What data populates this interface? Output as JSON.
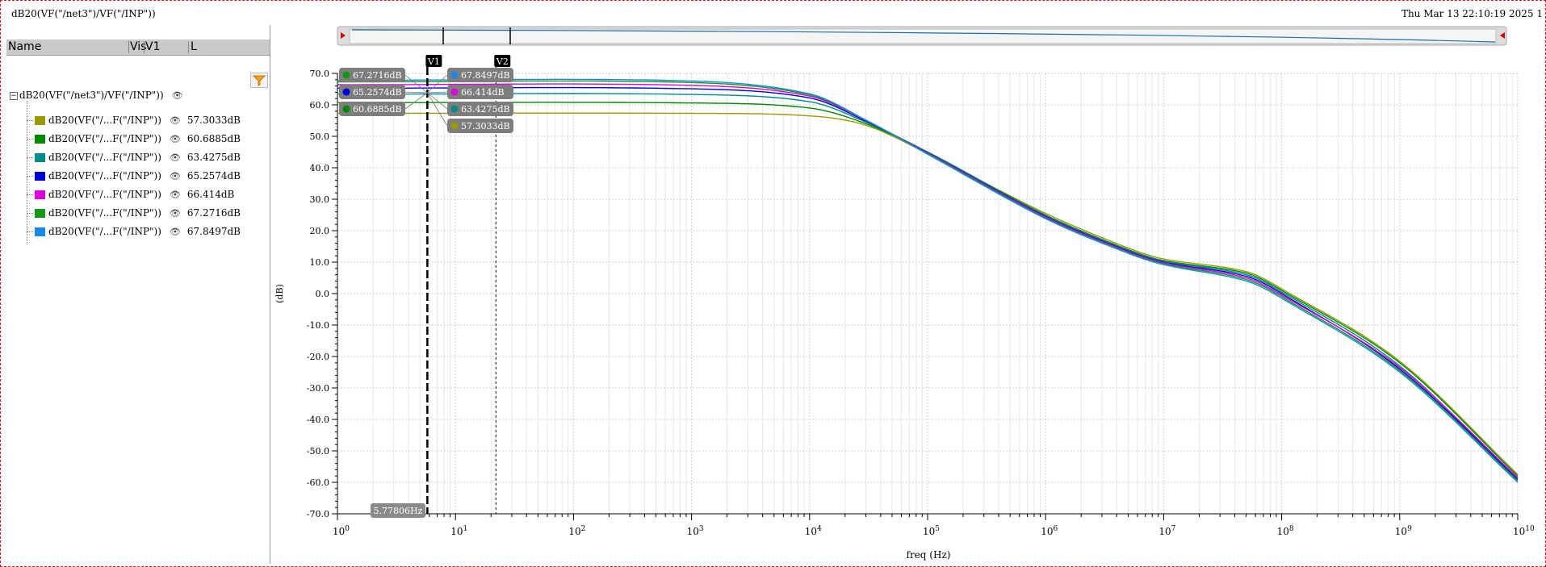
{
  "window": {
    "title": "dB20(VF(\"/net3\")/VF(\"/INP\"))",
    "timestamp": "Thu Mar 13 22:10:19 2025  1"
  },
  "panel": {
    "col_name": "Name",
    "col_vis": "Vis",
    "col_v1": "V1",
    "col_l": "L",
    "root_label": "dB20(VF(\"/net3\")/VF(\"/INP\"))",
    "traces": [
      {
        "label": "dB20(VF(\"/...F(\"/INP\"))",
        "value": "57.3033dB",
        "color": "#999900"
      },
      {
        "label": "dB20(VF(\"/...F(\"/INP\"))",
        "value": "60.6885dB",
        "color": "#008800"
      },
      {
        "label": "dB20(VF(\"/...F(\"/INP\"))",
        "value": "63.4275dB",
        "color": "#008a8a"
      },
      {
        "label": "dB20(VF(\"/...F(\"/INP\"))",
        "value": "65.2574dB",
        "color": "#0000dd"
      },
      {
        "label": "dB20(VF(\"/...F(\"/INP\"))",
        "value": "66.414dB",
        "color": "#dd00dd"
      },
      {
        "label": "dB20(VF(\"/...F(\"/INP\"))",
        "value": "67.2716dB",
        "color": "#119911"
      },
      {
        "label": "dB20(VF(\"/...F(\"/INP\"))",
        "value": "67.8497dB",
        "color": "#1a88e8"
      }
    ]
  },
  "markers": {
    "v1_label": "V1",
    "v2_label": "V2",
    "v1_freq_label": "5.77806Hz",
    "v1_freq": 5.77806,
    "v2_freq": 22,
    "v1_tags": [
      "67.2716dB",
      "65.2574dB",
      "60.6885dB"
    ],
    "v2_tags": [
      "67.8497dB",
      "66.414dB",
      "63.4275dB",
      "57.3033dB"
    ]
  },
  "chart_data": {
    "type": "line",
    "xlabel": "freq (Hz)",
    "ylabel": "(dB)",
    "xscale": "log",
    "xlim": [
      1,
      10000000000
    ],
    "ylim": [
      -70,
      70
    ],
    "y_ticks": [
      "70.0",
      "60.0",
      "50.0",
      "40.0",
      "30.0",
      "20.0",
      "10.0",
      "0.0",
      "-10.0",
      "-20.0",
      "-30.0",
      "-40.0",
      "-50.0",
      "-60.0",
      "-70.0"
    ],
    "x_ticks": [
      {
        "base": "10",
        "exp": "0"
      },
      {
        "base": "10",
        "exp": "1"
      },
      {
        "base": "10",
        "exp": "2"
      },
      {
        "base": "10",
        "exp": "3"
      },
      {
        "base": "10",
        "exp": "4"
      },
      {
        "base": "10",
        "exp": "5"
      },
      {
        "base": "10",
        "exp": "6"
      },
      {
        "base": "10",
        "exp": "7"
      },
      {
        "base": "10",
        "exp": "8"
      },
      {
        "base": "10",
        "exp": "9"
      },
      {
        "base": "10",
        "exp": "10"
      }
    ],
    "grid": true,
    "series": [
      {
        "color": "#999900",
        "x": [
          1,
          1000,
          10000,
          30000,
          100000,
          1000000,
          5000000,
          10000000,
          50000000,
          100000000,
          1000000000,
          10000000000
        ],
        "y": [
          57.3,
          57.3,
          56.5,
          53.5,
          44.5,
          25.5,
          14.5,
          11.0,
          7.0,
          1.5,
          -21.5,
          -57.5
        ]
      },
      {
        "color": "#008800",
        "x": [
          1,
          1000,
          10000,
          30000,
          100000,
          1000000,
          5000000,
          10000000,
          50000000,
          100000000,
          1000000000,
          10000000000
        ],
        "y": [
          60.7,
          60.6,
          59.0,
          54.0,
          45.0,
          25.0,
          14.0,
          10.5,
          6.5,
          1.0,
          -22.0,
          -58.0
        ]
      },
      {
        "color": "#008a8a",
        "x": [
          1,
          1000,
          10000,
          30000,
          100000,
          1000000,
          5000000,
          10000000,
          50000000,
          100000000,
          1000000000,
          10000000000
        ],
        "y": [
          63.4,
          63.3,
          61.0,
          54.5,
          45.0,
          24.8,
          13.8,
          10.3,
          6.0,
          0.5,
          -23.0,
          -59.5
        ]
      },
      {
        "color": "#0000dd",
        "x": [
          1,
          1000,
          10000,
          30000,
          100000,
          1000000,
          5000000,
          10000000,
          50000000,
          100000000,
          1000000000,
          10000000000
        ],
        "y": [
          65.3,
          65.1,
          62.2,
          54.8,
          44.8,
          24.5,
          13.5,
          10.0,
          5.5,
          0.0,
          -24.0,
          -59.0
        ]
      },
      {
        "color": "#dd00dd",
        "x": [
          1,
          1000,
          10000,
          30000,
          100000,
          1000000,
          5000000,
          10000000,
          50000000,
          100000000,
          1000000000,
          10000000000
        ],
        "y": [
          66.4,
          66.2,
          62.8,
          55.0,
          44.7,
          24.3,
          13.3,
          9.8,
          5.0,
          -0.5,
          -23.5,
          -58.5
        ]
      },
      {
        "color": "#119911",
        "x": [
          1,
          1000,
          10000,
          30000,
          100000,
          1000000,
          5000000,
          10000000,
          50000000,
          100000000,
          1000000000,
          10000000000
        ],
        "y": [
          67.3,
          67.1,
          63.2,
          55.1,
          44.5,
          24.0,
          13.0,
          9.5,
          4.5,
          -1.0,
          -24.5,
          -59.5
        ]
      },
      {
        "color": "#1a88e8",
        "x": [
          1,
          1000,
          10000,
          30000,
          100000,
          1000000,
          5000000,
          10000000,
          50000000,
          100000000,
          1000000000,
          10000000000
        ],
        "y": [
          67.8,
          67.6,
          63.5,
          55.2,
          44.3,
          23.8,
          12.8,
          9.2,
          4.0,
          -1.5,
          -25.0,
          -60.0
        ]
      }
    ]
  }
}
